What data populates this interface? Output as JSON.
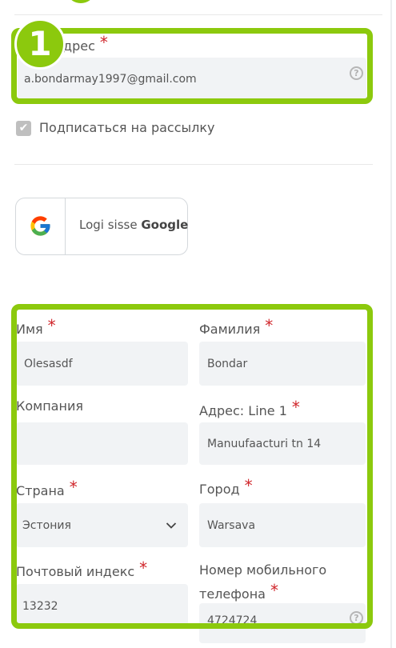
{
  "email_section": {
    "badge": "1",
    "label": "Адрес",
    "label_prefix": "дрес",
    "value": "a.bondarmay1997@gmail.com"
  },
  "newsletter": {
    "label": "Подписаться на рассылку",
    "checked": true
  },
  "google_login": {
    "prefix": "Logi sisse",
    "brand": "Google"
  },
  "form": {
    "first_name": {
      "label": "Имя",
      "value": "Olesasdf"
    },
    "last_name": {
      "label": "Фамилия",
      "value": "Bondar"
    },
    "company": {
      "label": "Компания",
      "value": ""
    },
    "address1": {
      "label": "Адрес: Line 1",
      "value": "Manuufaacturi tn 14"
    },
    "country": {
      "label": "Страна",
      "value": "Эстония"
    },
    "city": {
      "label": "Город",
      "value": "Warsava"
    },
    "zip": {
      "label": "Почтовый индекс",
      "value": "13232"
    },
    "phone": {
      "label_line1": "Номер мобильного",
      "label_line2": "телефона",
      "value": "4724724"
    }
  },
  "required_mark": "*",
  "help_glyph": "?",
  "colors": {
    "accent": "#8cc90d",
    "required": "#d0262b",
    "input_bg": "#f1f3f5"
  }
}
